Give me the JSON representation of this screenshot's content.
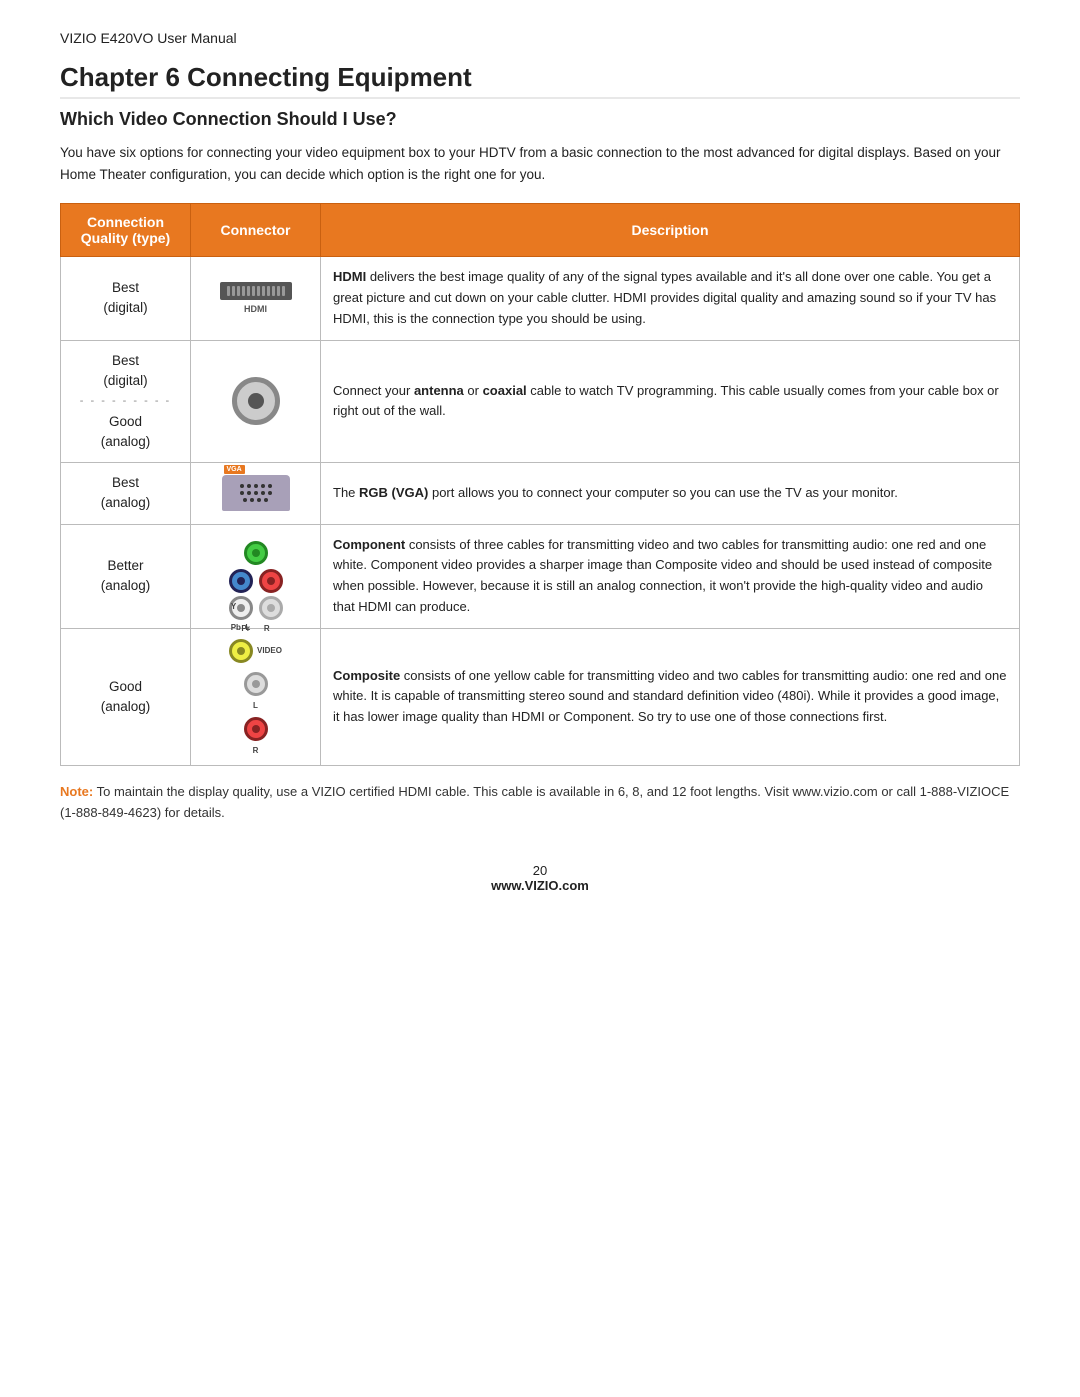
{
  "header": {
    "manual_title": "VIZIO E420VO User Manual"
  },
  "chapter": {
    "title": "Chapter 6 Connecting Equipment",
    "section_title": "Which Video Connection Should I Use?",
    "intro_text": "You have six options for connecting your video equipment box to your HDTV from a basic connection to the most advanced for digital displays. Based on your Home Theater configuration, you can decide which option is the right one for you."
  },
  "table": {
    "headers": {
      "quality": "Connection Quality (type)",
      "connector": "Connector",
      "description": "Description"
    },
    "rows": [
      {
        "quality": "Best\n(digital)",
        "connector_type": "hdmi",
        "connector_label": "HDMI",
        "description_html": "<b>HDMI</b> delivers the best image quality of any of the signal types available and it's all done over one cable. You get a great picture and cut down on your cable clutter. HDMI provides digital quality and amazing sound so if your TV has HDMI, this is the connection type you should be using."
      },
      {
        "quality": "Best\n(digital)\n\nGood\n(analog)",
        "connector_type": "coaxial",
        "connector_label": "",
        "description_html": "Connect your <b>antenna</b> or <b>coaxial</b> cable to watch TV programming. This cable usually comes from your cable box or right out of the wall."
      },
      {
        "quality": "Best\n(analog)",
        "connector_type": "vga",
        "connector_label": "VGA",
        "description_html": "The <b>RGB (VGA)</b> port allows you to connect your computer so you can use the TV as your monitor."
      },
      {
        "quality": "Better\n(analog)",
        "connector_type": "component",
        "connector_label": "",
        "description_html": "<b>Component</b> consists of three cables for transmitting video and two cables for transmitting audio: one red and one white. Component video provides a sharper image than Composite video and should be used instead of composite when possible. However, because it is still an analog connection, it won't provide the high-quality video and audio that HDMI can produce."
      },
      {
        "quality": "Good\n(analog)",
        "connector_type": "composite",
        "connector_label": "",
        "description_html": "<b>Composite</b> consists of one yellow cable for transmitting video and two cables for transmitting audio: one red and one white. It is capable of transmitting stereo sound and standard definition video (480i). While it provides a good image, it has lower image quality than HDMI or Component. So try to use one of those connections first."
      }
    ]
  },
  "note": {
    "label": "Note:",
    "text": " To maintain the display quality, use a VIZIO certified HDMI cable. This cable is available in 6, 8, and 12 foot lengths. Visit www.vizio.com or call 1-888-VIZIOCE (1-888-849-4623) for details."
  },
  "footer": {
    "page_number": "20",
    "website": "www.VIZIO.com"
  }
}
